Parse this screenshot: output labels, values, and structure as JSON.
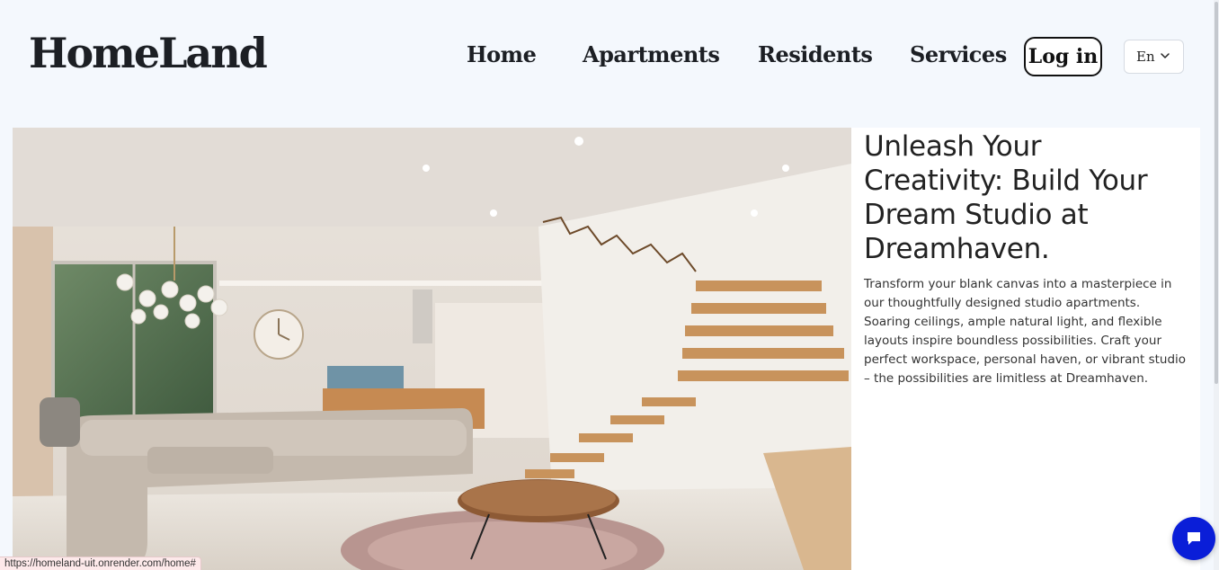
{
  "brand": {
    "logo": "HomeLand"
  },
  "nav": {
    "items": [
      {
        "label": "Home"
      },
      {
        "label": "Apartments"
      },
      {
        "label": "Residents"
      },
      {
        "label": "Services"
      }
    ],
    "login_label": "Log in",
    "language": {
      "selected": "En"
    }
  },
  "hero": {
    "title": "Unleash Your Creativity: Build Your Dream Studio at Dreamhaven.",
    "description": "Transform your blank canvas into a masterpiece in our thoughtfully designed studio apartments. Soaring ceilings, ample natural light, and flexible layouts inspire boundless possibilities. Craft your perfect workspace, personal haven, or vibrant studio – the possibilities are limitless at Dreamhaven."
  },
  "status_bar": {
    "url": "https://homeland-uit.onrender.com/home#"
  },
  "colors": {
    "background": "#f4f8fd",
    "chat_button": "#0a1ed8",
    "text_dark": "#1c1f24"
  },
  "icons": {
    "language_dropdown": "chevron-down-icon",
    "chat": "chat-bubble-icon"
  }
}
